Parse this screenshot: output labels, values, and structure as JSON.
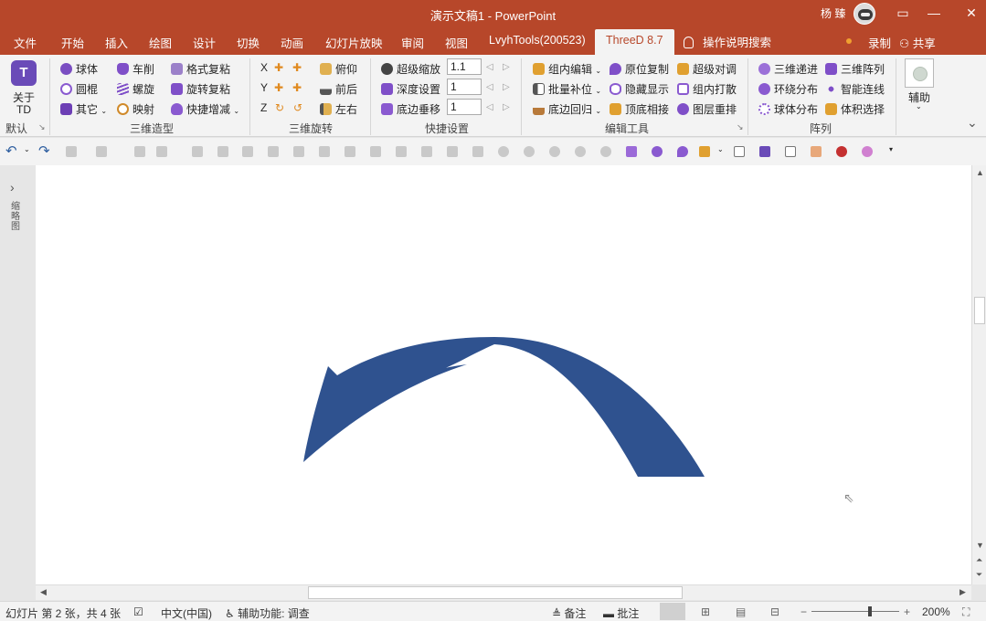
{
  "window": {
    "title": "演示文稿1  -  PowerPoint",
    "user": "杨 臻",
    "buttons": {
      "ribbon_opts": "▭",
      "minimize": "—",
      "maximize": "☐",
      "close": "✕"
    }
  },
  "tabs": {
    "items": [
      "文件",
      "开始",
      "插入",
      "绘图",
      "设计",
      "切换",
      "动画",
      "幻灯片放映",
      "审阅",
      "视图",
      "LvyhTools(200523)",
      "ThreeD 8.7"
    ],
    "active": "ThreeD 8.7",
    "tell_me": "操作说明搜索",
    "record": "录制",
    "share": "共享"
  },
  "ribbon": {
    "about": {
      "icon_text": "T",
      "label": "关于TD",
      "label_l1": "关于",
      "label_l2": "TD",
      "group": "默认"
    },
    "modeling": {
      "group": "三维造型",
      "col1": [
        "球体",
        "圆棍",
        "其它"
      ],
      "col2": [
        "车削",
        "螺旋",
        "映射"
      ],
      "col3": [
        "格式复粘",
        "旋转复粘",
        "快捷增减"
      ]
    },
    "rotation": {
      "group": "三维旋转",
      "axes": [
        "X",
        "Y",
        "Z"
      ],
      "items": [
        "俯仰",
        "前后",
        "左右"
      ]
    },
    "quick": {
      "group": "快捷设置",
      "items": [
        "超级缩放",
        "深度设置",
        "底边垂移"
      ],
      "values": [
        "1.1",
        "1",
        "1"
      ]
    },
    "edit": {
      "group": "编辑工具",
      "col1": [
        "组内编辑",
        "批量补位",
        "底边回归"
      ],
      "col2": [
        "原位复制",
        "隐藏显示",
        "顶底相接"
      ],
      "col3": [
        "超级对调",
        "组内打散",
        "图层重排"
      ]
    },
    "array": {
      "group": "阵列",
      "col1": [
        "三维递进",
        "环绕分布",
        "球体分布"
      ],
      "col2": [
        "三维阵列",
        "智能连线",
        "体积选择"
      ]
    },
    "aux": {
      "label": "辅助"
    }
  },
  "left_pane": {
    "label": "缩略图"
  },
  "slide": {
    "shape": "curved-arrow",
    "fill": "#2f528f"
  },
  "status": {
    "slide_info": "幻灯片 第 2 张，共 4 张",
    "language": "中文(中国)",
    "accessibility": "辅助功能: 调查",
    "notes": "备注",
    "comments": "批注",
    "zoom": "200%"
  },
  "colors": {
    "accent": "#b7472a",
    "ribbon_bg": "#f3f3f3",
    "arrow": "#2f528f"
  }
}
